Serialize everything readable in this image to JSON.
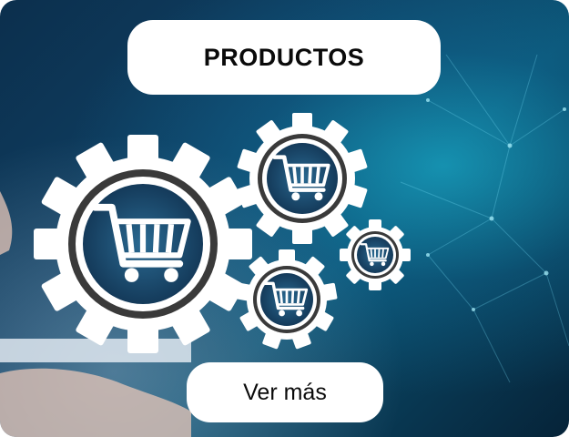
{
  "card": {
    "title": "PRODUCTOS",
    "cta_label": "Ver más"
  },
  "icons": {
    "gears": [
      "cart-gear-icon",
      "cart-gear-icon",
      "cart-gear-icon",
      "cart-gear-icon"
    ],
    "cart": "shopping-cart-icon"
  },
  "colors": {
    "pill_background": "#ffffff",
    "text": "#0a0a0a",
    "bg_dark": "#0c2f4d",
    "bg_glow": "#1ec8e6",
    "gear": "#ffffff",
    "gear_inner": "#1c4a6e"
  }
}
